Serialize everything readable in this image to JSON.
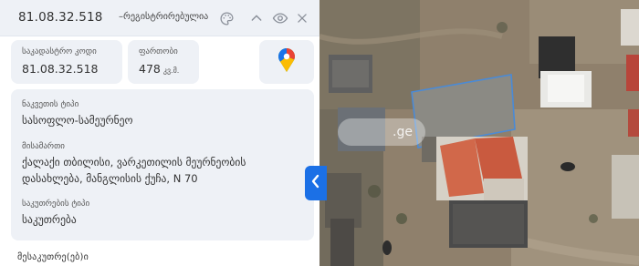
{
  "header": {
    "cadastral_code": "81.08.32.518",
    "status": "–რეგისტრირებულია",
    "icons": [
      "palette-icon",
      "chevron-up-icon",
      "eye-icon",
      "close-icon"
    ]
  },
  "cadastral_card": {
    "label": "საკადასტრო კოდი",
    "value": "81.08.32.518"
  },
  "area_card": {
    "label": "ფართობი",
    "value": "478",
    "unit": "კვ.მ."
  },
  "maps_button": {
    "icon": "google-maps-pin-icon"
  },
  "details": {
    "purpose_label": "ნაკვეთის ტიპი",
    "purpose_value": "სასოფლო-სამეურნეო",
    "address_label": "მისამართი",
    "address_line1": "ქალაქი თბილისი, ვარკეთილის მეურნეობის",
    "address_line2": "დასახლება, მანგლისის ქუჩა, N 70",
    "ownership_label": "საკუთრების ტიპი",
    "ownership_value": "საკუთრება"
  },
  "owners_section": {
    "label": "მესაკუთრე(ებ)ი"
  },
  "map": {
    "collapse_icon": "chevron-left-icon",
    "watermark": ".ge",
    "colors": {
      "accent": "#1b70e6",
      "parcel_outline": "#4a8ad6",
      "ground": "#8a7a66"
    }
  }
}
